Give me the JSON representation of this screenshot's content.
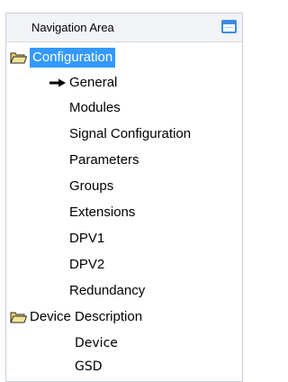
{
  "header": {
    "title": "Navigation Area"
  },
  "tree": {
    "configuration": {
      "label": "Configuration",
      "icon": "folder-open-icon",
      "selected": true,
      "children": [
        {
          "label": "General",
          "current": true
        },
        {
          "label": "Modules"
        },
        {
          "label": "Signal Configuration"
        },
        {
          "label": "Parameters"
        },
        {
          "label": "Groups"
        },
        {
          "label": "Extensions"
        },
        {
          "label": "DPV1"
        },
        {
          "label": "DPV2"
        },
        {
          "label": "Redundancy"
        }
      ]
    },
    "device_description": {
      "label": "Device Description",
      "icon": "folder-open-icon",
      "children": [
        {
          "label": "Device"
        },
        {
          "label": "GSD"
        }
      ]
    }
  },
  "colors": {
    "selection": "#3399ff",
    "header_bg": "#f1f3f6",
    "window_icon": "#3d8be3",
    "folder_fill": "#f0e08a",
    "folder_outline": "#2b2b2b"
  }
}
